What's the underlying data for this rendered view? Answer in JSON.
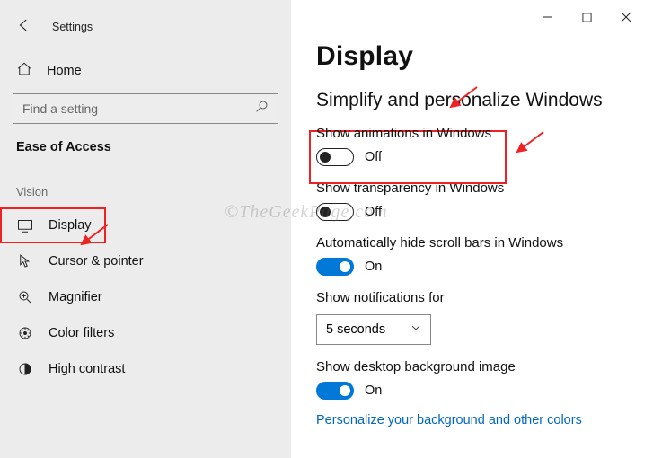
{
  "app_title": "Settings",
  "sidebar": {
    "home_label": "Home",
    "search_placeholder": "Find a setting",
    "category": "Ease of Access",
    "group": "Vision",
    "items": [
      {
        "label": "Display"
      },
      {
        "label": "Cursor & pointer"
      },
      {
        "label": "Magnifier"
      },
      {
        "label": "Color filters"
      },
      {
        "label": "High contrast"
      }
    ]
  },
  "content": {
    "page_title": "Display",
    "section_title": "Simplify and personalize Windows",
    "settings": {
      "animations": {
        "label": "Show animations in Windows",
        "state_text": "Off"
      },
      "transparency": {
        "label": "Show transparency in Windows",
        "state_text": "Off"
      },
      "scrollbars": {
        "label": "Automatically hide scroll bars in Windows",
        "state_text": "On"
      },
      "notifications": {
        "label": "Show notifications for",
        "value": "5 seconds"
      },
      "background": {
        "label": "Show desktop background image",
        "state_text": "On"
      },
      "personalize_link": "Personalize your background and other colors"
    }
  },
  "watermark": "©TheGeekPage.com"
}
